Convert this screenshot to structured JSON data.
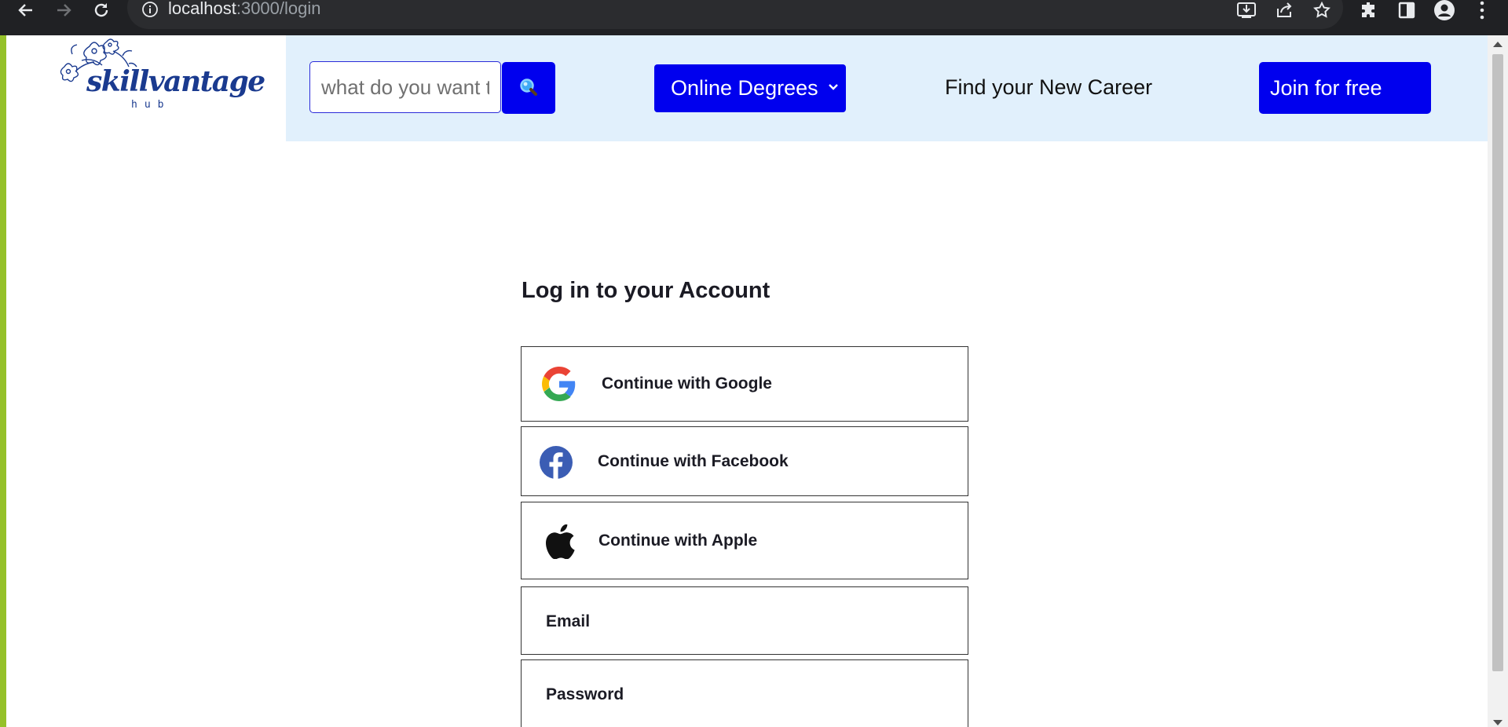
{
  "browser": {
    "url_host": "localhost",
    "url_rest": ":3000/login"
  },
  "header": {
    "logo_text": "skillvantage",
    "logo_sub": "hub",
    "search_placeholder": "what do you want to learn?",
    "search_icon": "magnifier-icon",
    "degrees_label": "Online Degrees",
    "career_label": "Find your New Career",
    "join_label": "Join for free"
  },
  "login": {
    "title": "Log in to your Account",
    "google_label": "Continue with Google",
    "facebook_label": "Continue with Facebook",
    "apple_label": "Continue with Apple",
    "email_label": "Email",
    "password_label": "Password"
  },
  "colors": {
    "accent": "#0000ee",
    "header_bg": "#e1f0fc",
    "logo": "#1a3a8f",
    "chrome": "#202124"
  }
}
